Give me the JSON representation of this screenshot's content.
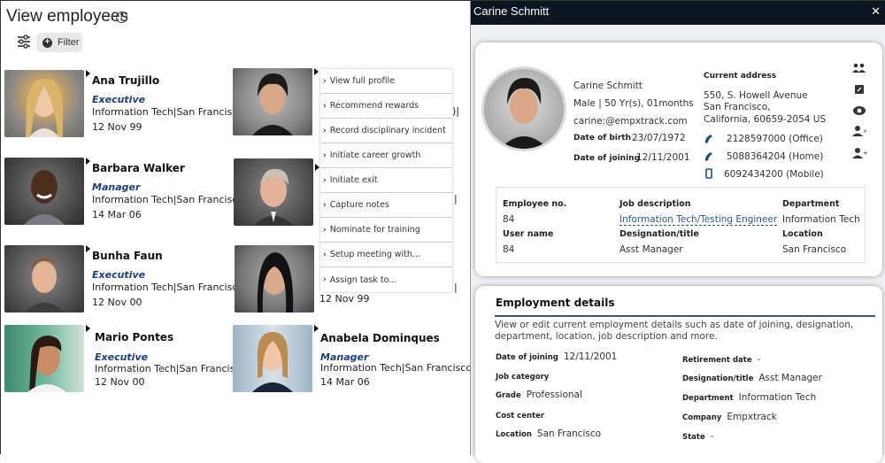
{
  "left": {
    "title": "View employees",
    "filter_label": "Filter",
    "employees": [
      {
        "name": "Ana Trujillo",
        "role": "Executive",
        "dept": "Information Tech|San Francisco|",
        "date": "12 Nov 99"
      },
      {
        "name": "Barbara Walker",
        "role": "Manager",
        "dept": "Information Tech|San Francisco|",
        "date": "14 Mar 06"
      },
      {
        "name": "Bunha Faun",
        "role": "Executive",
        "dept": "Information Tech|San Francisco|",
        "date": "12 Nov 00"
      },
      {
        "name": "Mario Pontes",
        "role": "Executive",
        "dept": "Information Tech|San Francis",
        "date": "12 Nov 00"
      },
      {
        "name": "",
        "role": "",
        "dept": "",
        "date": ""
      },
      {
        "name": "",
        "role": "",
        "dept": "",
        "date": ""
      },
      {
        "name": "",
        "role": "",
        "dept": "",
        "date": "12 Nov 99"
      },
      {
        "name": "Anabela Dominques",
        "role": "Manager",
        "dept": "Information Tech|San Francisco|",
        "date": "14 Mar 06"
      }
    ],
    "context_menu": [
      "View full profile",
      "Recommend rewards",
      "Record disciplinary incident",
      "Initiate career growth",
      "Initiate exit",
      "Capture notes",
      "Nominate for training",
      "Setup meeting with...",
      "Assign task to..."
    ]
  },
  "right": {
    "header_title": "Carine Schmitt",
    "profile": {
      "name": "Carine Schmitt",
      "gender_age": "Male | 50 Yr(s), 01months",
      "email": "carine:@empxtrack.com",
      "dob_label": "Date of birth",
      "dob": "23/07/1972",
      "doj_label": "Date of joining",
      "doj": "12/11/2001",
      "address_label": "Current address",
      "address_line1": "550, S. Howell Avenue",
      "address_line2": "San Francisco,",
      "address_line3": "California,  60659-2054 US",
      "phone_office": "2128597000 (Office)",
      "phone_home": "5088364204 (Home)",
      "phone_mobile": "6092434200 (Mobile)",
      "action_icons": [
        "team-icon",
        "edit-icon",
        "view-icon",
        "remove-user-icon",
        "add-user-icon"
      ]
    },
    "id_box": {
      "emp_no_label": "Employee no.",
      "emp_no": "84",
      "job_desc_label": "Job description",
      "job_desc": "Information Tech/Testing Engineer",
      "department_label": "Department",
      "department": "Information Tech",
      "username_label": "User name",
      "username": "84",
      "designation_label": "Designation/title",
      "designation": "Asst Manager",
      "location_label": "Location",
      "location": "San Francisco"
    },
    "employment": {
      "title": "Employment details",
      "description": "View or edit current employment details such as date of joining, designation, department, location, job description and more.",
      "left_fields": [
        {
          "label": "Date of joining",
          "value": "12/11/2001"
        },
        {
          "label": "Job category",
          "value": ""
        },
        {
          "label": "Grade",
          "value": "Professional"
        },
        {
          "label": "Cost center",
          "value": ""
        },
        {
          "label": "Location",
          "value": "San Francisco"
        }
      ],
      "right_fields": [
        {
          "label": "Retirement date",
          "value": "-"
        },
        {
          "label": "Designation/title",
          "value": "Asst Manager"
        },
        {
          "label": "Department",
          "value": "Information Tech"
        },
        {
          "label": "Company",
          "value": "Empxtrack"
        },
        {
          "label": "State",
          "value": "-"
        }
      ]
    }
  },
  "colors": {
    "header_bg": "#0b1620",
    "role_blue": "#1f3d7a",
    "link_blue": "#2a5a96",
    "rule": "#3a5577"
  }
}
